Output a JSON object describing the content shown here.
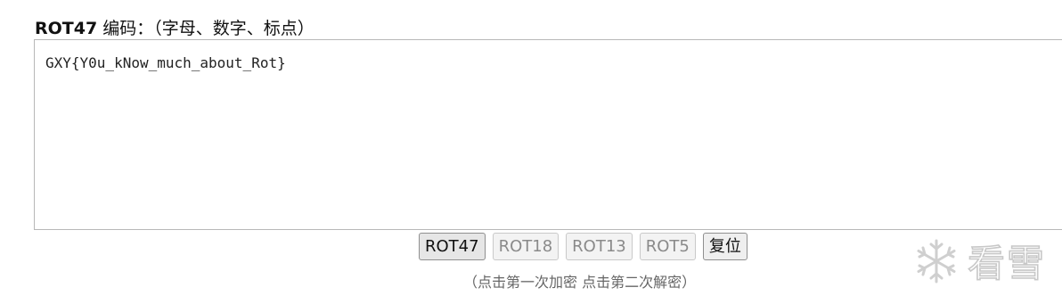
{
  "header": {
    "label_strong": "ROT47",
    "label_rest": " 编码：（字母、数字、标点）"
  },
  "editor": {
    "value": "GXY{Y0u_kNow_much_about_Rot}"
  },
  "buttons": [
    {
      "label": "ROT47",
      "state": "active"
    },
    {
      "label": "ROT18",
      "state": "normal"
    },
    {
      "label": "ROT13",
      "state": "normal"
    },
    {
      "label": "ROT5",
      "state": "normal"
    },
    {
      "label": "复位",
      "state": "reset"
    }
  ],
  "hint": "（点击第一次加密 点击第二次解密）",
  "watermark": {
    "icon": "snowflake-icon",
    "text": "看雪"
  }
}
